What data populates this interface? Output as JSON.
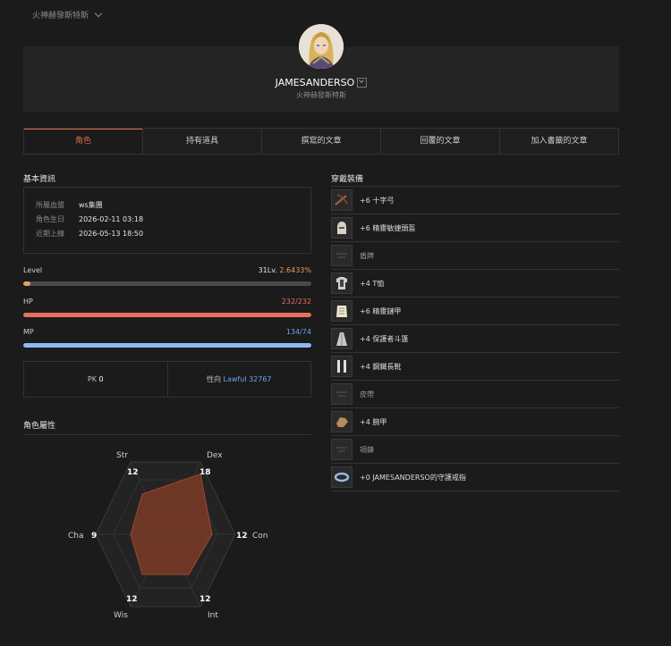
{
  "server_select": {
    "label": "火神赫發斯特斯"
  },
  "profile": {
    "name": "JAMESANDERSO",
    "server": "火神赫發斯特斯",
    "avatar_icon": "character-portrait"
  },
  "tabs": [
    {
      "label": "角色",
      "active": true
    },
    {
      "label": "持有道具",
      "active": false
    },
    {
      "label": "撰寫的文章",
      "active": false
    },
    {
      "label": "回覆的文章",
      "active": false
    },
    {
      "label": "加入書籤的文章",
      "active": false
    }
  ],
  "basic_info": {
    "title": "基本資訊",
    "rows": [
      {
        "key": "所屬血盟",
        "value": "ws集團"
      },
      {
        "key": "角色生日",
        "value": "2026-02-11 03:18"
      },
      {
        "key": "近期上線",
        "value": "2026-05-13 18:50"
      }
    ]
  },
  "stats_bars": {
    "level": {
      "label": "Level",
      "value_prefix": "31Lv.",
      "value_pct": "2.6433%",
      "fill": 0.026,
      "color": "#e0a060"
    },
    "hp": {
      "label": "HP",
      "value": "232/232",
      "fill": 1.0,
      "color": "#e8705f",
      "value_color": "#e8705f"
    },
    "mp": {
      "label": "MP",
      "value": "134/74",
      "fill": 1.0,
      "color": "#8fb9f2",
      "value_color": "#6ea3ee"
    }
  },
  "pk": {
    "pk_label": "PK",
    "pk_value": "0",
    "align_label": "性向",
    "align_value": "Lawful 32767"
  },
  "attributes": {
    "title": "角色屬性",
    "labels": {
      "str": "Str",
      "dex": "Dex",
      "con": "Con",
      "int": "Int",
      "wis": "Wis",
      "cha": "Cha"
    },
    "values": {
      "str": "12",
      "dex": "18",
      "con": "12",
      "int": "12",
      "wis": "12",
      "cha": "9"
    }
  },
  "equipment": {
    "title": "穿戴裝備",
    "items": [
      {
        "name": "+6 十字弓",
        "icon": "crossbow-icon",
        "empty": false
      },
      {
        "name": "+6 精靈敏捷頭盔",
        "icon": "helmet-icon",
        "empty": false
      },
      {
        "name": "盾牌",
        "icon": "empty-slot-icon",
        "empty": true
      },
      {
        "name": "+4 T恤",
        "icon": "tshirt-icon",
        "empty": false
      },
      {
        "name": "+6 精靈鏈甲",
        "icon": "chainmail-icon",
        "empty": false
      },
      {
        "name": "+4 保護者斗篷",
        "icon": "cloak-icon",
        "empty": false
      },
      {
        "name": "+4 鋼鐵長靴",
        "icon": "boots-icon",
        "empty": false
      },
      {
        "name": "皮帶",
        "icon": "empty-slot-icon",
        "empty": true
      },
      {
        "name": "+4 腕甲",
        "icon": "gauntlet-icon",
        "empty": false
      },
      {
        "name": "項鍊",
        "icon": "empty-slot-icon",
        "empty": true
      },
      {
        "name": "+0 JAMESANDERSO的守護戒指",
        "icon": "ring-icon",
        "empty": false
      }
    ]
  },
  "colors": {
    "accent": "#d96a4a",
    "link": "#6ea3ee",
    "bg": "#1b1b1b"
  }
}
